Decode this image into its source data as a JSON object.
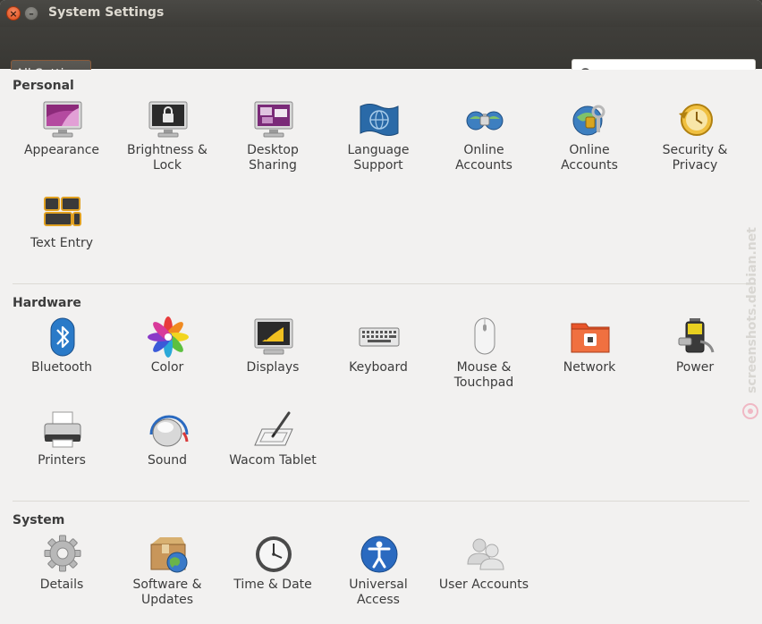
{
  "window": {
    "title": "System Settings"
  },
  "toolbar": {
    "all_settings_label": "All Settings",
    "search_placeholder": "",
    "search_value": ""
  },
  "sections": {
    "personal": {
      "title": "Personal",
      "items": [
        {
          "label": "Appearance",
          "icon": "appearance-icon"
        },
        {
          "label": "Brightness &\nLock",
          "icon": "brightness-lock-icon"
        },
        {
          "label": "Desktop\nSharing",
          "icon": "desktop-sharing-icon"
        },
        {
          "label": "Language\nSupport",
          "icon": "language-support-icon"
        },
        {
          "label": "Online\nAccounts",
          "icon": "online-accounts-icon"
        },
        {
          "label": "Online\nAccounts",
          "icon": "online-accounts-keys-icon"
        },
        {
          "label": "Security &\nPrivacy",
          "icon": "security-privacy-icon"
        },
        {
          "label": "Text Entry",
          "icon": "text-entry-icon"
        }
      ]
    },
    "hardware": {
      "title": "Hardware",
      "items": [
        {
          "label": "Bluetooth",
          "icon": "bluetooth-icon"
        },
        {
          "label": "Color",
          "icon": "color-icon"
        },
        {
          "label": "Displays",
          "icon": "displays-icon"
        },
        {
          "label": "Keyboard",
          "icon": "keyboard-icon"
        },
        {
          "label": "Mouse &\nTouchpad",
          "icon": "mouse-icon"
        },
        {
          "label": "Network",
          "icon": "network-icon"
        },
        {
          "label": "Power",
          "icon": "power-icon"
        },
        {
          "label": "Printers",
          "icon": "printer-icon"
        },
        {
          "label": "Sound",
          "icon": "sound-icon"
        },
        {
          "label": "Wacom Tablet",
          "icon": "wacom-tablet-icon"
        }
      ]
    },
    "system": {
      "title": "System",
      "items": [
        {
          "label": "Details",
          "icon": "details-gear-icon"
        },
        {
          "label": "Software &\nUpdates",
          "icon": "software-updates-icon"
        },
        {
          "label": "Time & Date",
          "icon": "clock-icon"
        },
        {
          "label": "Universal\nAccess",
          "icon": "universal-access-icon"
        },
        {
          "label": "User Accounts",
          "icon": "user-accounts-icon"
        }
      ]
    }
  },
  "watermark": {
    "text": "screenshots.debian.net"
  }
}
